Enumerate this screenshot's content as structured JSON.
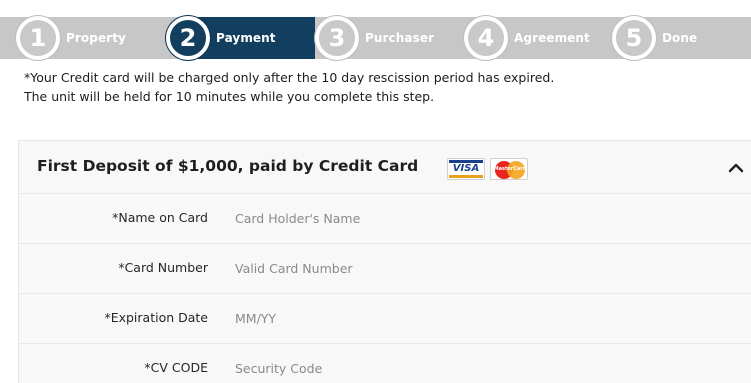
{
  "stepper": {
    "steps": [
      {
        "number": "1",
        "label": "Property"
      },
      {
        "number": "2",
        "label": "Payment",
        "active": true
      },
      {
        "number": "3",
        "label": "Purchaser"
      },
      {
        "number": "4",
        "label": "Agreement"
      },
      {
        "number": "5",
        "label": "Done"
      }
    ]
  },
  "notes": {
    "line1": "*Your Credit card will be charged only after the 10 day rescission period has expired.",
    "line2": "The unit will be held for 10 minutes while you complete this step."
  },
  "deposit": {
    "title": "First Deposit of $1,000, paid by Credit Card",
    "card_logos": {
      "visa": "VISA",
      "mastercard": "MasterCard"
    },
    "collapse_icon": "chevron-up-icon",
    "fields": [
      {
        "label": "*Name on Card",
        "placeholder": "Card Holder's Name"
      },
      {
        "label": "*Card Number",
        "placeholder": "Valid Card Number"
      },
      {
        "label": "*Expiration Date",
        "placeholder": "MM/YY"
      },
      {
        "label": "*CV CODE",
        "placeholder": "Security Code"
      }
    ]
  },
  "colors": {
    "active_step": "#123f5f",
    "inactive_step": "#c7c7c7",
    "panel_background": "#f8f8f8"
  }
}
